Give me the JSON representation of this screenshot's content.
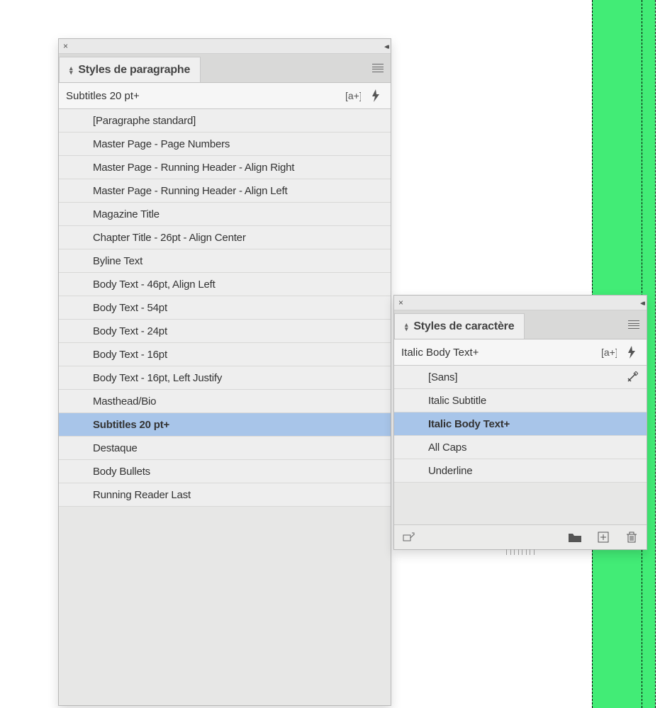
{
  "paragraph_styles_panel": {
    "tab_title": "Styles de paragraphe",
    "current_style": "Subtitles 20 pt+",
    "items": [
      {
        "label": "[Paragraphe standard]",
        "selected": false,
        "has_shortcut": false
      },
      {
        "label": "Master Page - Page Numbers",
        "selected": false,
        "has_shortcut": false
      },
      {
        "label": "Master Page - Running Header - Align Right",
        "selected": false,
        "has_shortcut": false
      },
      {
        "label": "Master Page - Running Header - Align Left",
        "selected": false,
        "has_shortcut": false
      },
      {
        "label": "Magazine Title",
        "selected": false,
        "has_shortcut": false
      },
      {
        "label": "Chapter Title - 26pt - Align Center",
        "selected": false,
        "has_shortcut": false
      },
      {
        "label": "Byline Text",
        "selected": false,
        "has_shortcut": false
      },
      {
        "label": "Body Text - 46pt, Align Left",
        "selected": false,
        "has_shortcut": false
      },
      {
        "label": "Body Text - 54pt",
        "selected": false,
        "has_shortcut": false
      },
      {
        "label": "Body Text - 24pt",
        "selected": false,
        "has_shortcut": false
      },
      {
        "label": "Body Text - 16pt",
        "selected": false,
        "has_shortcut": false
      },
      {
        "label": "Body Text - 16pt, Left Justify",
        "selected": false,
        "has_shortcut": false
      },
      {
        "label": "Masthead/Bio",
        "selected": false,
        "has_shortcut": false
      },
      {
        "label": "Subtitles 20 pt+",
        "selected": true,
        "has_shortcut": false
      },
      {
        "label": "Destaque",
        "selected": false,
        "has_shortcut": false
      },
      {
        "label": "Body Bullets",
        "selected": false,
        "has_shortcut": false
      },
      {
        "label": "Running Reader Last",
        "selected": false,
        "has_shortcut": false
      }
    ]
  },
  "character_styles_panel": {
    "tab_title": "Styles de caractère",
    "current_style": "Italic Body Text+",
    "items": [
      {
        "label": "[Sans]",
        "selected": false,
        "has_shortcut": true
      },
      {
        "label": "Italic Subtitle",
        "selected": false,
        "has_shortcut": false
      },
      {
        "label": "Italic Body Text+",
        "selected": true,
        "has_shortcut": false
      },
      {
        "label": "All Caps",
        "selected": false,
        "has_shortcut": false
      },
      {
        "label": "Underline",
        "selected": false,
        "has_shortcut": false
      }
    ]
  },
  "colors": {
    "document_fill": "#42ec76",
    "selection": "#a8c5e9"
  }
}
